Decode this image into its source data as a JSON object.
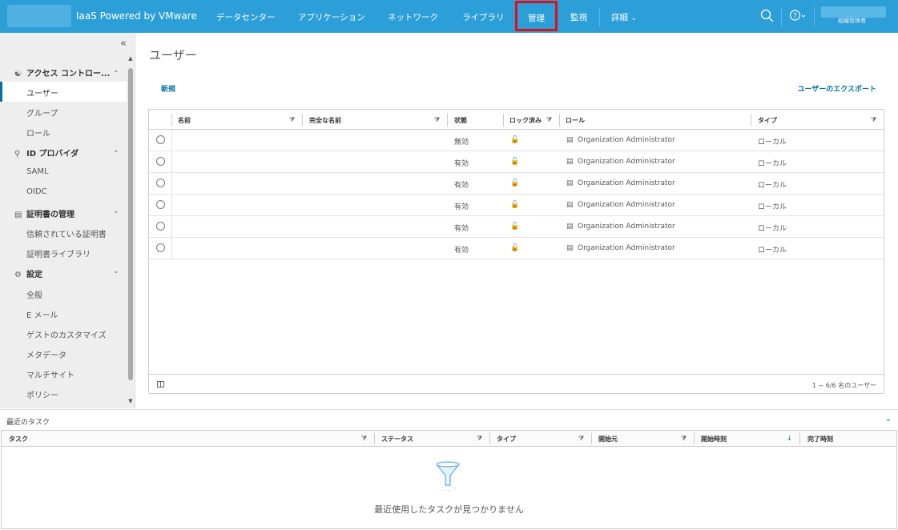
{
  "header": {
    "app_title": "IaaS Powered by VMware",
    "nav": [
      "データセンター",
      "アプリケーション",
      "ネットワーク",
      "ライブラリ",
      "管理",
      "監視",
      "詳細"
    ],
    "user_role": "組織管理者",
    "icons": [
      "search-icon",
      "help-icon"
    ],
    "brand_color": "#2c9fd8"
  },
  "sidebar": {
    "groups": [
      {
        "label": "アクセス コントロー...",
        "icon": "users-icon",
        "items": [
          "ユーザー",
          "グループ",
          "ロール"
        ]
      },
      {
        "label": "ID プロバイダ",
        "icon": "id-icon",
        "items": [
          "SAML",
          "OIDC"
        ]
      },
      {
        "label": "証明書の管理",
        "icon": "certificate-icon",
        "items": [
          "信頼されている証明書",
          "証明書ライブラリ"
        ]
      },
      {
        "label": "設定",
        "icon": "gear-icon",
        "items": [
          "全般",
          "E メール",
          "ゲストのカスタマイズ",
          "メタデータ",
          "マルチサイト",
          "ポリシー"
        ]
      }
    ],
    "selected": "ユーザー"
  },
  "main": {
    "title": "ユーザー",
    "new_label": "新規",
    "export_label": "ユーザーのエクスポート",
    "columns": [
      "名前",
      "完全な名前",
      "状態",
      "ロック済み",
      "ロール",
      "タイプ"
    ],
    "rows": [
      {
        "name": "",
        "full_name": "",
        "status": "無効",
        "role": "Organization Administrator",
        "type": "ローカル"
      },
      {
        "name": "",
        "full_name": "",
        "status": "有効",
        "role": "Organization Administrator",
        "type": "ローカル"
      },
      {
        "name": "",
        "full_name": "",
        "status": "有効",
        "role": "Organization Administrator",
        "type": "ローカル"
      },
      {
        "name": "",
        "full_name": "",
        "status": "有効",
        "role": "Organization Administrator",
        "type": "ローカル"
      },
      {
        "name": "",
        "full_name": "",
        "status": "有効",
        "role": "Organization Administrator",
        "type": "ローカル"
      },
      {
        "name": "",
        "full_name": "",
        "status": "有効",
        "role": "Organization Administrator",
        "type": "ローカル"
      }
    ],
    "footer_count": "1 ~ 6/6 名のユーザー"
  },
  "tasks": {
    "title": "最近のタスク",
    "columns": [
      "タスク",
      "ステータス",
      "タイプ",
      "開始元",
      "開始時刻",
      "完了時刻"
    ],
    "empty_message": "最近使用したタスクが見つかりません"
  }
}
